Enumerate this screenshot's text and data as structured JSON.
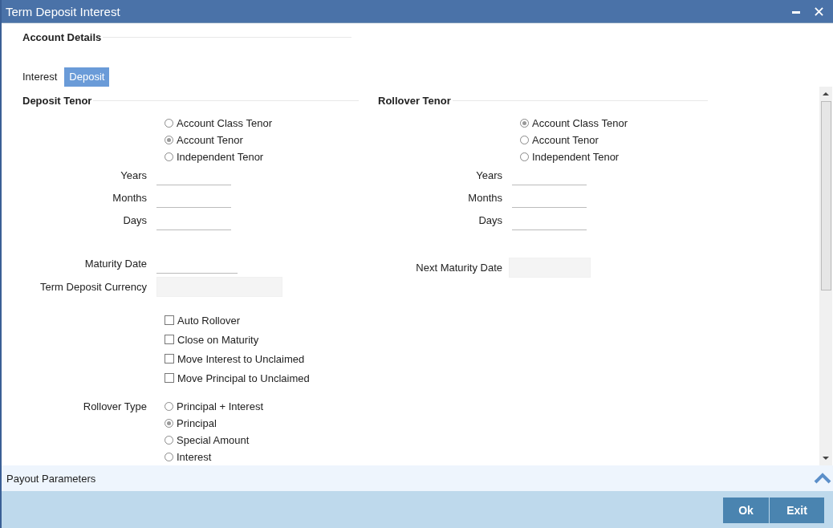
{
  "window": {
    "title": "Term Deposit Interest"
  },
  "account_details": {
    "title": "Account Details"
  },
  "tabs": [
    {
      "label": "Interest",
      "selected": false
    },
    {
      "label": "Deposit",
      "selected": true
    }
  ],
  "deposit_tenor": {
    "title": "Deposit Tenor",
    "options": [
      {
        "label": "Account Class Tenor",
        "selected": false
      },
      {
        "label": "Account Tenor",
        "selected": true
      },
      {
        "label": "Independent Tenor",
        "selected": false
      }
    ],
    "fields": [
      {
        "label": "Years"
      },
      {
        "label": "Months"
      },
      {
        "label": "Days"
      }
    ],
    "date_fields": [
      {
        "label": "Maturity Date",
        "kind": "line"
      },
      {
        "label": "Term Deposit Currency",
        "kind": "box"
      }
    ]
  },
  "rollover_tenor": {
    "title": "Rollover Tenor",
    "options": [
      {
        "label": "Account Class Tenor",
        "selected": true
      },
      {
        "label": "Account Tenor",
        "selected": false
      },
      {
        "label": "Independent Tenor",
        "selected": false
      }
    ],
    "fields": [
      {
        "label": "Years"
      },
      {
        "label": "Months"
      },
      {
        "label": "Days"
      }
    ],
    "date_fields": [
      {
        "label": "Next Maturity Date",
        "kind": "box"
      }
    ]
  },
  "checkboxes": [
    {
      "label": "Auto Rollover",
      "checked": false
    },
    {
      "label": "Close on Maturity",
      "checked": false
    },
    {
      "label": "Move Interest to Unclaimed",
      "checked": false
    },
    {
      "label": "Move Principal to Unclaimed",
      "checked": false
    }
  ],
  "rollover_type": {
    "label": "Rollover Type",
    "options": [
      {
        "label": "Principal + Interest",
        "selected": false
      },
      {
        "label": "Principal",
        "selected": true
      },
      {
        "label": "Special Amount",
        "selected": false
      },
      {
        "label": "Interest",
        "selected": false
      }
    ]
  },
  "payout_section": {
    "title": "Payout Parameters"
  },
  "buttons": [
    "Ok",
    "Exit"
  ]
}
